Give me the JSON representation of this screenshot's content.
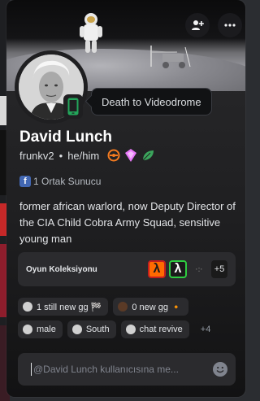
{
  "profile": {
    "display_name": "David Lunch",
    "username": "frunkv2",
    "separator": "•",
    "pronouns": "he/him",
    "custom_status": "Death to Videodrome",
    "status_icon": "mobile-phone-icon",
    "status_color": "#23a55a"
  },
  "badges": [
    "hypesquad-balance-icon",
    "nitro-gem-icon",
    "leaf-icon"
  ],
  "mutual": {
    "label": "1 Ortak Sunucu",
    "icon_letter": "f"
  },
  "bio": "former african warlord, now Deputy Director of the CIA Child Cobra Army Squad, sensitive young man",
  "collection": {
    "label": "Oyun Koleksiyonu",
    "game1_glyph": "λ",
    "game2_glyph": "λ",
    "game3_text": "·:·",
    "more": "+5"
  },
  "roles": {
    "row1": [
      {
        "label": "1 still new gg 🏁",
        "dot_color": "#d0d0d0"
      },
      {
        "label": "0 new gg 🔸",
        "dot_color": "#5a3a26"
      }
    ],
    "row2": [
      {
        "label": "male",
        "dot_color": "#c8c8c8"
      },
      {
        "label": "South",
        "dot_color": "#c8c8c8"
      },
      {
        "label": "chat revive",
        "dot_color": "#c8c8c8"
      }
    ],
    "more": "+4"
  },
  "message": {
    "placeholder": "@David Lunch kullanıcısına me..."
  },
  "colors": {
    "accent_green": "#23a55a",
    "card_top": "#2a2a2c",
    "card_bottom": "#121213"
  }
}
